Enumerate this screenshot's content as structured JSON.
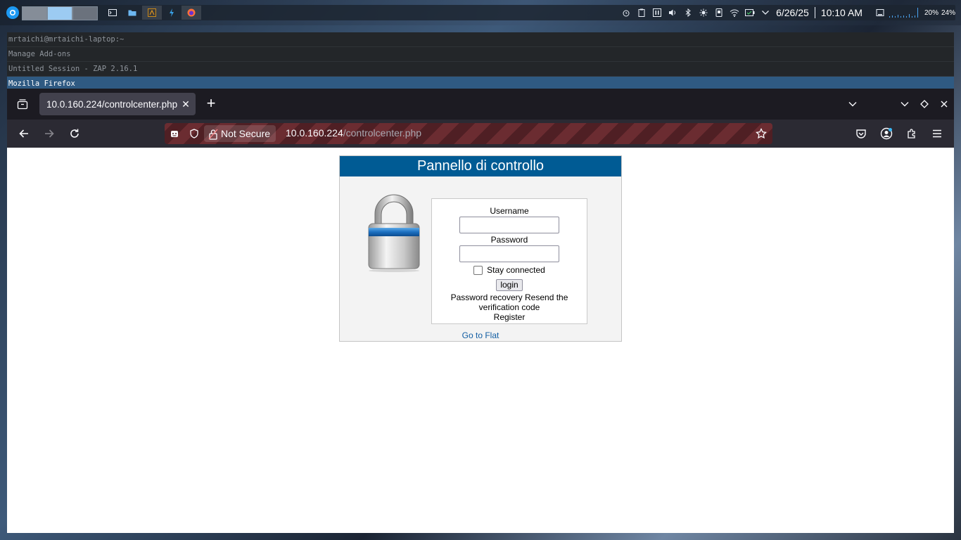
{
  "panel": {
    "date": "6/26/25",
    "time": "10:10 AM",
    "cpu_pct": "20%",
    "mem_pct": "24%"
  },
  "windows": [
    {
      "title": "mrtaichi@mrtaichi-laptop:~",
      "active": false
    },
    {
      "title": "Manage Add-ons",
      "active": false
    },
    {
      "title": "Untitled Session - ZAP 2.16.1",
      "active": false
    },
    {
      "title": "Mozilla Firefox",
      "active": true
    }
  ],
  "browser": {
    "tab_title": "10.0.160.224/controlcenter.php",
    "security_label": "Not Secure",
    "url_host": "10.0.160.224",
    "url_path": "/controlcenter.php"
  },
  "page": {
    "heading": "Pannello di controllo",
    "username_label": "Username",
    "password_label": "Password",
    "username_value": "",
    "password_value": "",
    "stay_connected_label": "Stay connected",
    "login_button": "login",
    "password_recovery": "Password recovery",
    "resend_verification": "Resend the verification code",
    "register": "Register",
    "go_to_flat": "Go to Flat"
  },
  "colors": {
    "header_blue": "#005b94",
    "link_blue": "#125ea3",
    "active_window": "#2f5a82"
  }
}
